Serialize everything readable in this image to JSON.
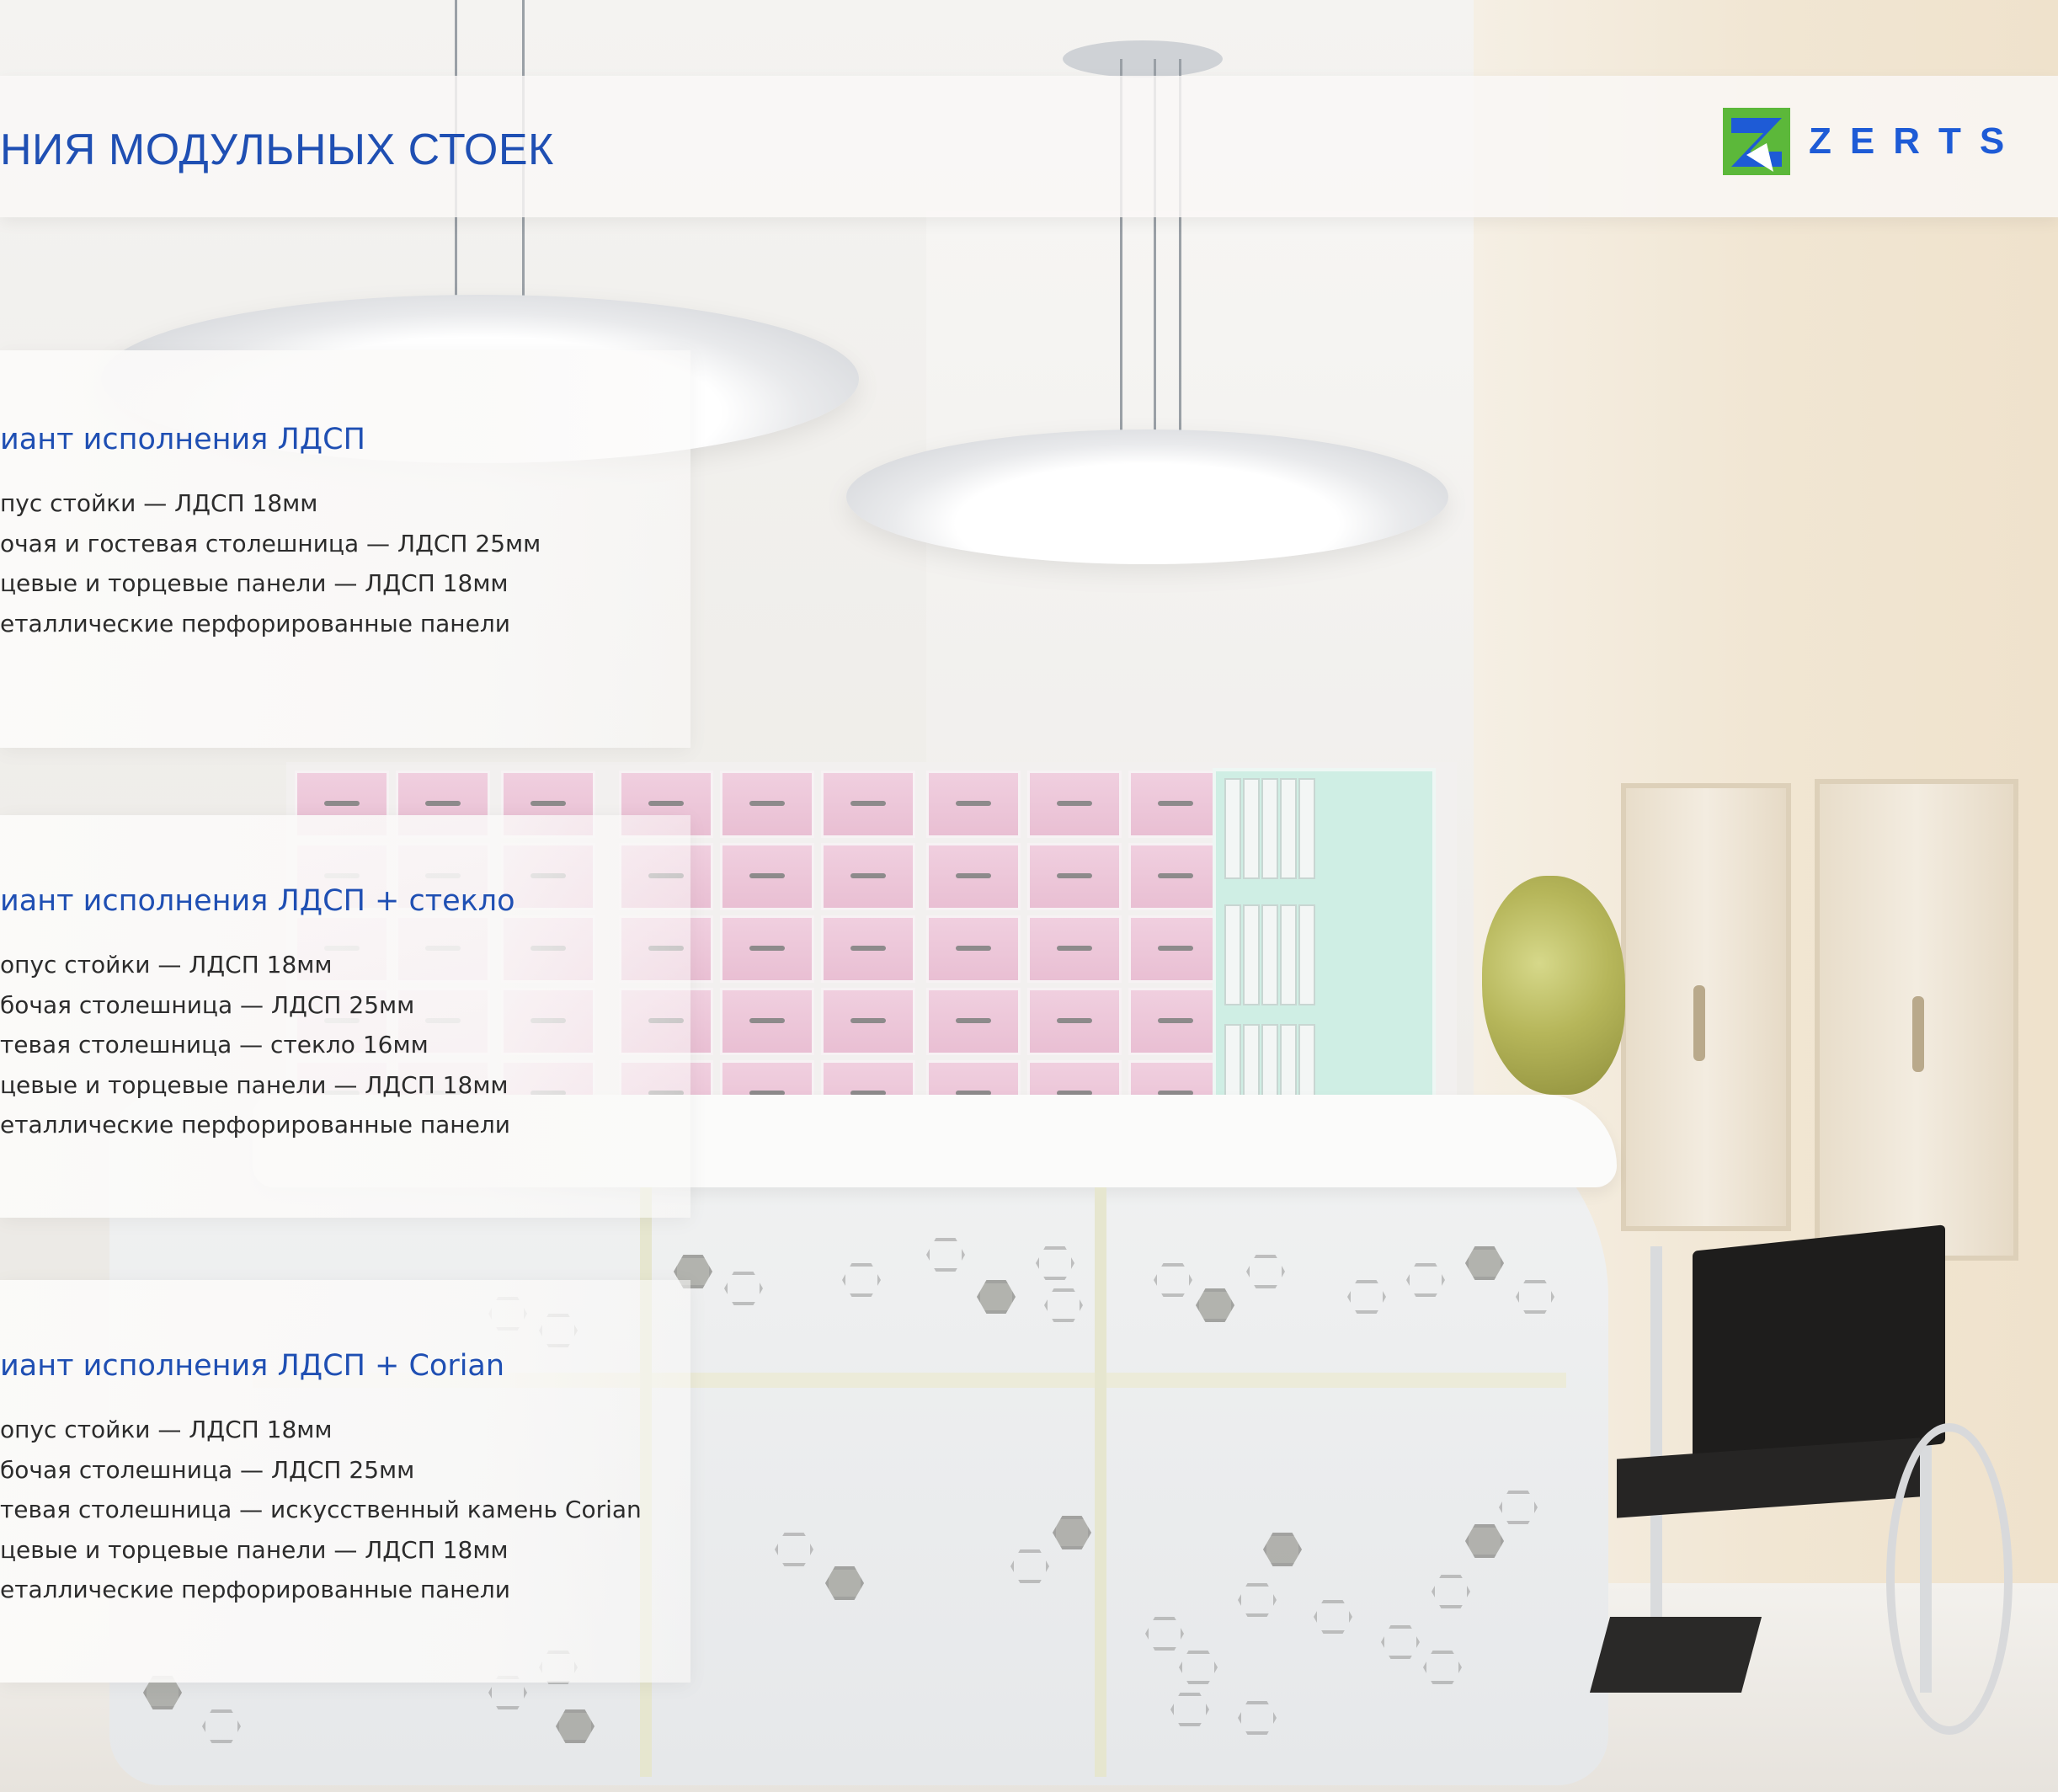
{
  "header": {
    "title": "НИЯ МОДУЛЬНЫХ СТОЕК",
    "logo_text": "ZERTS",
    "logo_colors": {
      "green": "#5cb83a",
      "blue": "#1e5bd6"
    }
  },
  "variants": [
    {
      "title": "иант исполнения  ЛДСП",
      "specs": [
        "пус стойки — ЛДСП 18мм",
        "очая и гостевая столешница — ЛДСП 25мм",
        "цевые и торцевые панели — ЛДСП 18мм",
        "еталлические перфорированные панели"
      ]
    },
    {
      "title": "иант исполнения ЛДСП + стекло",
      "specs": [
        "опус стойки — ЛДСП 18мм",
        "бочая столешница — ЛДСП 25мм",
        "тевая столешница — стекло 16мм",
        "цевые и торцевые панели — ЛДСП 18мм",
        "еталлические перфорированные панели"
      ]
    },
    {
      "title": "иант исполнения ЛДСП + Corian",
      "specs": [
        "опус стойки — ЛДСП 18мм",
        "бочая столешница — ЛДСП 25мм",
        "тевая столешница — искусственный камень Corian",
        "цевые и торцевые панели — ЛДСП 18мм",
        "еталлические перфорированные панели"
      ]
    }
  ],
  "colors": {
    "accent_blue": "#1f4fb3",
    "text": "#2c2c2c",
    "drawer_pink": "#ecc4d8",
    "shelf_mint": "#cfeee4"
  }
}
